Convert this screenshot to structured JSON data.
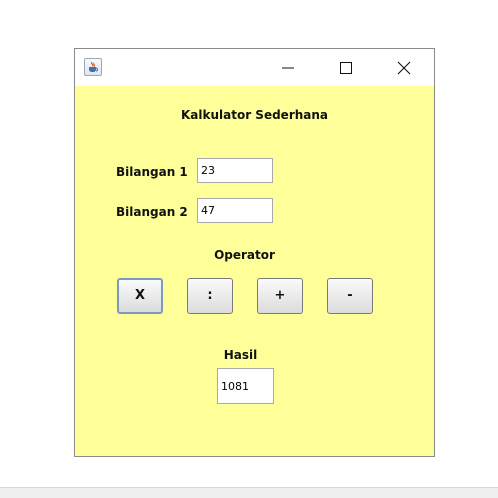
{
  "window": {
    "title": "",
    "icon": "java-cup-icon",
    "controls": [
      "minimize-icon",
      "maximize-icon",
      "close-icon"
    ],
    "background_color": "#ffff99"
  },
  "app": {
    "heading": "Kalkulator Sederhana",
    "bilangan1": {
      "label": "Bilangan 1",
      "value": "23"
    },
    "bilangan2": {
      "label": "Bilangan 2",
      "value": "47"
    },
    "operator_label": "Operator",
    "operators": [
      "X",
      ":",
      "+",
      "-"
    ],
    "hasil_label": "Hasil",
    "hasil_value": "1081"
  }
}
